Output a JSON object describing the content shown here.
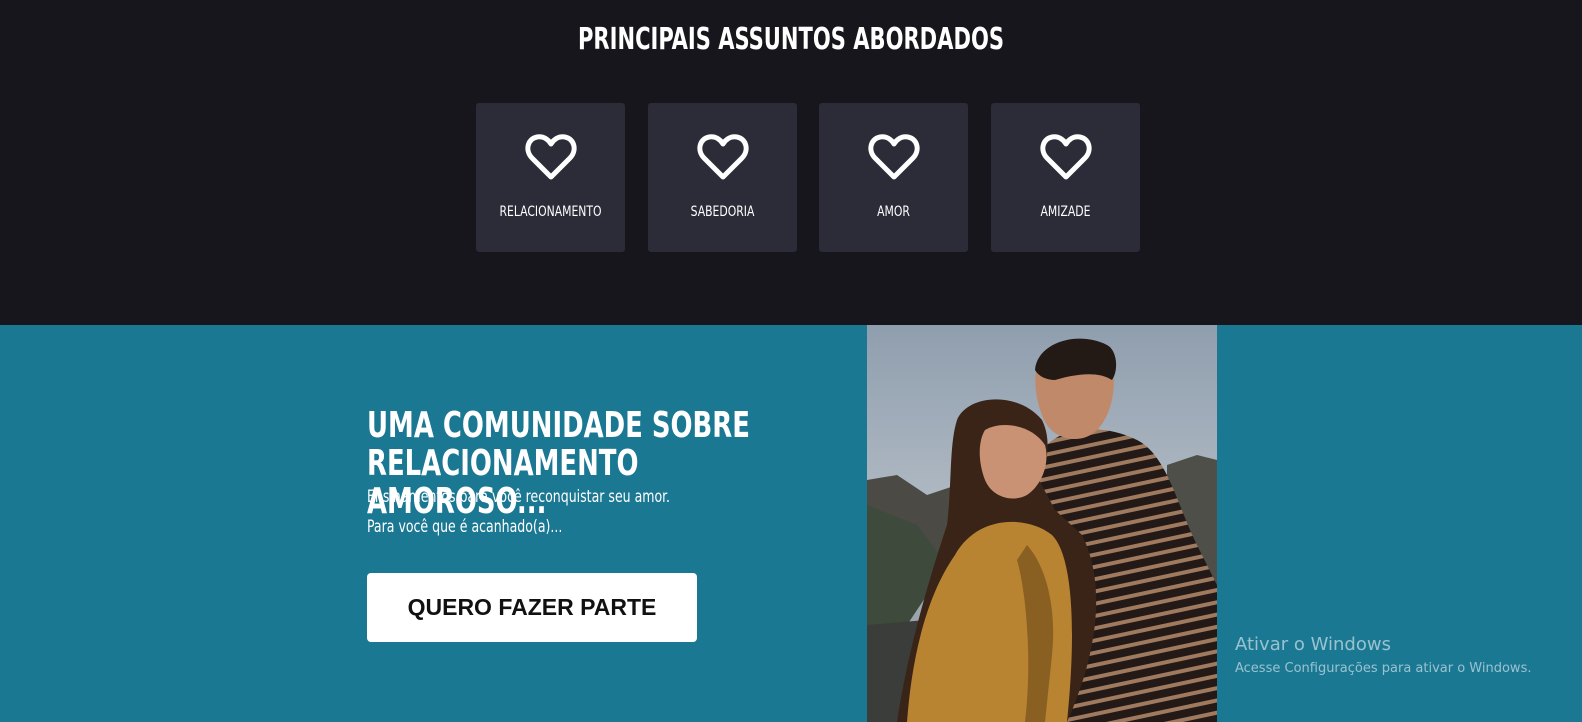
{
  "topics": {
    "title": "PRINCIPAIS ASSUNTOS ABORDADOS",
    "cards": [
      {
        "label": "RELACIONAMENTO",
        "icon": "heart-icon"
      },
      {
        "label": "SABEDORIA",
        "icon": "heart-icon"
      },
      {
        "label": "AMOR",
        "icon": "heart-icon"
      },
      {
        "label": "AMIZADE",
        "icon": "heart-icon"
      }
    ]
  },
  "hero": {
    "title": "UMA COMUNIDADE SOBRE RELACIONAMENTO AMOROSO...",
    "subtitle_1": "Ensinamentos para você reconquistar seu amor.",
    "subtitle_2": "Para você que é acanhado(a)...",
    "cta_label": "QUERO FAZER PARTE"
  },
  "watermark": {
    "title": "Ativar o Windows",
    "description": "Acesse Configurações para ativar o Windows."
  },
  "colors": {
    "topics_bg": "#16161c",
    "card_bg": "#2b2c38",
    "hero_bg": "#1b7893",
    "cta_bg": "#ffffff"
  }
}
